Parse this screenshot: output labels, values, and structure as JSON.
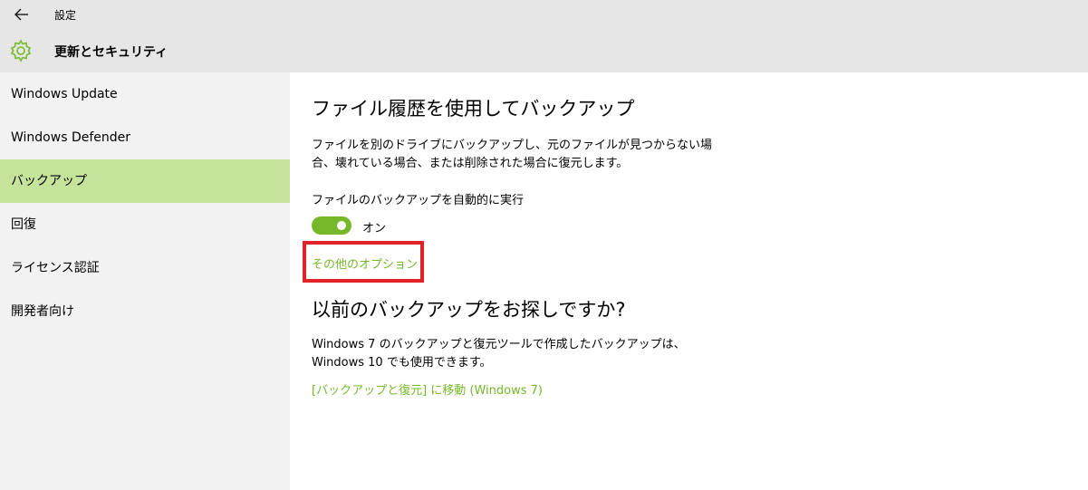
{
  "titlebar": {
    "back_icon": "back-arrow-icon",
    "title": "設定"
  },
  "header": {
    "icon": "gear-icon",
    "icon_color": "#76b82a",
    "title": "更新とセキュリティ"
  },
  "sidebar": {
    "items": [
      {
        "label": "Windows Update",
        "active": false
      },
      {
        "label": "Windows Defender",
        "active": false
      },
      {
        "label": "バックアップ",
        "active": true
      },
      {
        "label": "回復",
        "active": false
      },
      {
        "label": "ライセンス認証",
        "active": false
      },
      {
        "label": "開発者向け",
        "active": false
      }
    ],
    "active_color": "#c5e39b"
  },
  "content": {
    "section1": {
      "heading": "ファイル履歴を使用してバックアップ",
      "description": "ファイルを別のドライブにバックアップし、元のファイルが見つからない場合、壊れている場合、または削除された場合に復元します。",
      "toggle_label": "ファイルのバックアップを自動的に実行",
      "toggle_state": "オン",
      "toggle_on": true,
      "more_options_link": "その他のオプション"
    },
    "section2": {
      "heading": "以前のバックアップをお探しですか?",
      "description": "Windows 7 のバックアップと復元ツールで作成したバックアップは、Windows 10 でも使用できます。",
      "link": "[バックアップと復元] に移動 (Windows 7)"
    },
    "accent_color": "#76b82a",
    "highlight_color": "#e32128"
  }
}
